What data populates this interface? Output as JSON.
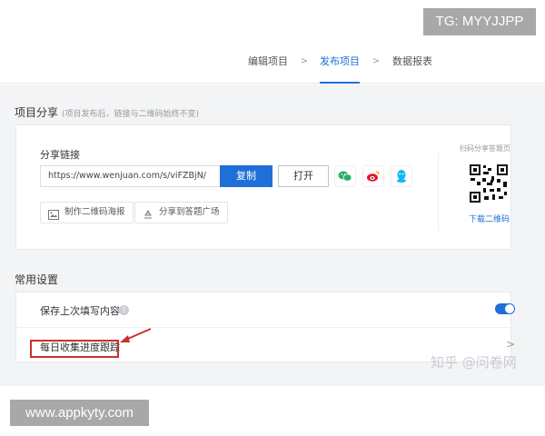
{
  "overlay_top_right": "TG: MYYJJPP",
  "overlay_bottom_left": "www.appkyty.com",
  "tabs": [
    {
      "label": "编辑项目",
      "active": false
    },
    {
      "label": "发布项目",
      "active": true
    },
    {
      "label": "数据报表",
      "active": false
    }
  ],
  "tab_separator": ">",
  "share": {
    "title": "项目分享",
    "hint": "(项目发布后，链接与二维码始终不变)",
    "link_label": "分享链接",
    "url": "https://www.wenjuan.com/s/viFZBjN/",
    "copy_label": "复制",
    "open_label": "打开",
    "social_icons": [
      "wechat-icon",
      "weibo-icon",
      "qq-icon"
    ],
    "make_poster_label": "制作二维码海报",
    "share_square_label": "分享到答题广场",
    "qr_caption": "扫码分享答题页",
    "qr_download_label": "下载二维码"
  },
  "settings": {
    "title": "常用设置",
    "items": [
      {
        "label": "保存上次填写内容",
        "help": "?",
        "toggle_on": true
      },
      {
        "label": "每日收集进度跟踪",
        "chevron": ">"
      }
    ]
  },
  "watermark": "知乎 @问卷网",
  "colors": {
    "accent": "#1f6fd6",
    "highlight": "#c8312a",
    "wechat": "#2aae67",
    "weibo": "#e6162d",
    "qq": "#12b7f5"
  }
}
